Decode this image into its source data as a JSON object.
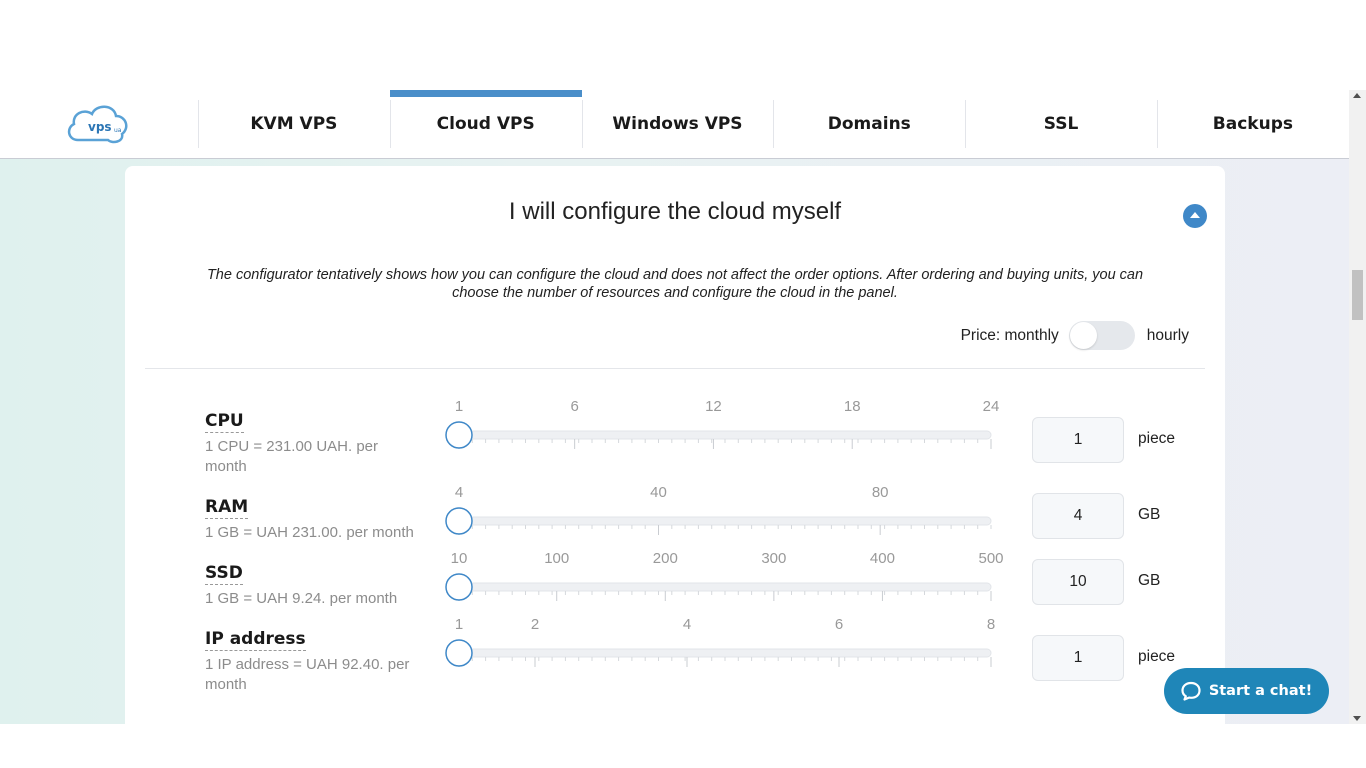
{
  "nav": {
    "logo_text": "vps",
    "logo_sub": "ua",
    "tabs": [
      {
        "label": "KVM VPS",
        "active": false
      },
      {
        "label": "Cloud VPS",
        "active": true
      },
      {
        "label": "Windows VPS",
        "active": false
      },
      {
        "label": "Domains",
        "active": false
      },
      {
        "label": "SSL",
        "active": false
      },
      {
        "label": "Backups",
        "active": false
      }
    ]
  },
  "configurator": {
    "title": "I will configure the cloud myself",
    "note": "The configurator tentatively shows how you can configure the cloud and does not affect the order options. After ordering and buying units, you can choose the number of resources and configure the cloud in the panel.",
    "price_label": "Price: monthly",
    "price_alt": "hourly",
    "rows": [
      {
        "label": "CPU",
        "desc": "1 CPU = 231.00 UAH. per month",
        "ticks": [
          "1",
          "6",
          "12",
          "18",
          "24"
        ],
        "min": 1,
        "max": 24,
        "value": "1",
        "unit": "piece"
      },
      {
        "label": "RAM",
        "desc": "1 GB = UAH 231.00. per month",
        "ticks": [
          "4",
          "40",
          "80"
        ],
        "min": 4,
        "max": 100,
        "value": "4",
        "unit": "GB"
      },
      {
        "label": "SSD",
        "desc": "1 GB = UAH 9.24. per month",
        "ticks": [
          "10",
          "100",
          "200",
          "300",
          "400",
          "500"
        ],
        "min": 10,
        "max": 500,
        "value": "10",
        "unit": "GB"
      },
      {
        "label": "IP address",
        "desc": "1 IP address = UAH 92.40. per month",
        "ticks": [
          "1",
          "2",
          "4",
          "6",
          "8"
        ],
        "min": 1,
        "max": 8,
        "value": "1",
        "unit": "piece"
      }
    ]
  },
  "chat": {
    "label": "Start a chat!"
  },
  "colors": {
    "accent": "#4a8ec9",
    "chat": "#1f86b8",
    "slider_handle": "#3f88c8"
  }
}
